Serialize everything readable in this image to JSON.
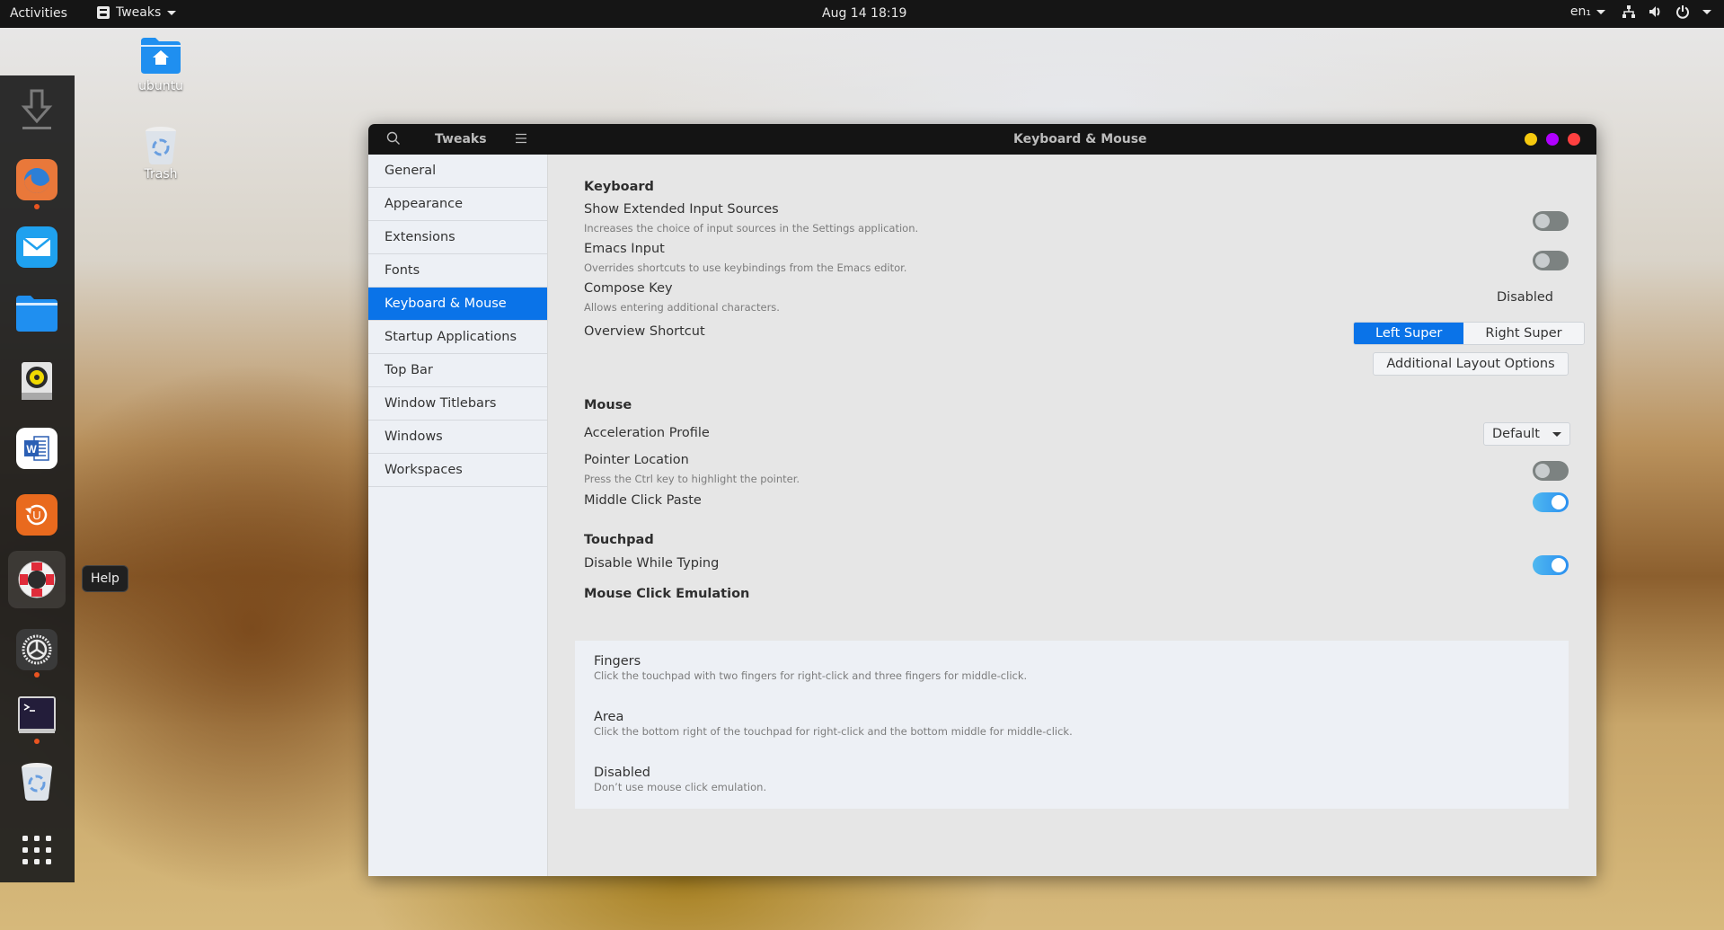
{
  "topbar": {
    "activities": "Activities",
    "app_menu": "Tweaks",
    "clock": "Aug 14  18:19",
    "language": "en₁",
    "icons": [
      "network-icon",
      "volume-icon",
      "power-icon"
    ]
  },
  "desktop": {
    "icons": [
      {
        "label": "ubuntu",
        "icon": "home-folder-icon"
      },
      {
        "label": "Trash",
        "icon": "trash-icon"
      }
    ]
  },
  "dock": {
    "items": [
      {
        "name": "downloads",
        "icon": "download-icon",
        "running": false
      },
      {
        "name": "firefox",
        "icon": "firefox-icon",
        "running": true
      },
      {
        "name": "mail",
        "icon": "mail-icon",
        "running": false
      },
      {
        "name": "files",
        "icon": "folder-icon",
        "running": false
      },
      {
        "name": "rhythmbox",
        "icon": "speaker-icon",
        "running": false
      },
      {
        "name": "word",
        "icon": "word-icon",
        "running": false
      },
      {
        "name": "software-updater",
        "icon": "updater-icon",
        "running": false
      },
      {
        "name": "help",
        "icon": "lifebuoy-icon",
        "running": false
      },
      {
        "name": "settings",
        "icon": "settings-gear-icon",
        "running": true
      },
      {
        "name": "terminal",
        "icon": "terminal-icon",
        "running": true
      },
      {
        "name": "trash",
        "icon": "trash-icon",
        "running": false
      },
      {
        "name": "show-apps",
        "icon": "app-grid-icon",
        "running": false
      }
    ],
    "tooltip": "Help"
  },
  "window": {
    "app_title": "Tweaks",
    "page_title": "Keyboard & Mouse",
    "controls": {
      "minimize": "#f6c90e",
      "maximize": "#b000ff",
      "close": "#ff4040"
    }
  },
  "sidebar": {
    "items": [
      {
        "label": "General"
      },
      {
        "label": "Appearance"
      },
      {
        "label": "Extensions"
      },
      {
        "label": "Fonts"
      },
      {
        "label": "Keyboard & Mouse",
        "selected": true
      },
      {
        "label": "Startup Applications"
      },
      {
        "label": "Top Bar"
      },
      {
        "label": "Window Titlebars"
      },
      {
        "label": "Windows"
      },
      {
        "label": "Workspaces"
      }
    ]
  },
  "keyboard": {
    "title": "Keyboard",
    "extended_input": {
      "label": "Show Extended Input Sources",
      "desc": "Increases the choice of input sources in the Settings application.",
      "on": false
    },
    "emacs_input": {
      "label": "Emacs Input",
      "desc": "Overrides shortcuts to use keybindings from the Emacs editor.",
      "on": false
    },
    "compose_key": {
      "label": "Compose Key",
      "desc": "Allows entering additional characters.",
      "value": "Disabled"
    },
    "overview_shortcut": {
      "label": "Overview Shortcut",
      "options": [
        "Left Super",
        "Right Super"
      ],
      "selected": "Left Super"
    },
    "additional_layout_button": "Additional Layout Options"
  },
  "mouse": {
    "title": "Mouse",
    "acceleration_profile": {
      "label": "Acceleration Profile",
      "value": "Default"
    },
    "pointer_location": {
      "label": "Pointer Location",
      "desc": "Press the Ctrl key to highlight the pointer.",
      "on": false
    },
    "middle_click_paste": {
      "label": "Middle Click Paste",
      "on": true
    }
  },
  "touchpad": {
    "title": "Touchpad",
    "disable_while_typing": {
      "label": "Disable While Typing",
      "on": true
    },
    "click_emulation": {
      "title": "Mouse Click Emulation",
      "options": [
        {
          "label": "Fingers",
          "desc": "Click the touchpad with two fingers for right-click and three fingers for middle-click."
        },
        {
          "label": "Area",
          "desc": "Click the bottom right of the touchpad for right-click and the bottom middle for middle-click."
        },
        {
          "label": "Disabled",
          "desc": "Don’t use mouse click emulation."
        }
      ]
    }
  },
  "colors": {
    "accent": "#0a73e8",
    "switch_on": "#2a8ff0",
    "switch_off": "#7c8281",
    "running_indicator": "#e95420"
  }
}
